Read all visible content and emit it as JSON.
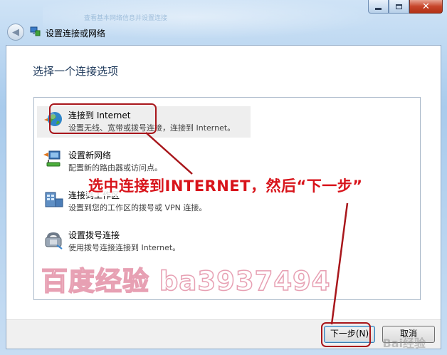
{
  "window": {
    "title": "设置连接或网络",
    "ghost_text": "查看基本网络信息并设置连接",
    "caption": {
      "minimize": "minimize-icon",
      "maximize": "maximize-icon",
      "close": "close-icon"
    }
  },
  "dialog": {
    "heading": "选择一个连接选项",
    "options": [
      {
        "title": "连接到 Internet",
        "desc": "设置无线、宽带或拨号连接，连接到 Internet。",
        "icon": "globe-network-icon",
        "selected": true
      },
      {
        "title": "设置新网络",
        "desc": "配置新的路由器或访问点。",
        "icon": "router-icon",
        "selected": false
      },
      {
        "title": "连接到工作区",
        "desc": "设置到您的工作区的拨号或 VPN 连接。",
        "icon": "workplace-icon",
        "selected": false
      },
      {
        "title": "设置拨号连接",
        "desc": "使用拨号连接连接到 Internet。",
        "icon": "phone-icon",
        "selected": false
      }
    ],
    "buttons": {
      "next": "下一步(N)",
      "cancel": "取消"
    }
  },
  "annotation": {
    "text": "选中连接到INTERNET，然后“下一步”",
    "color": "#d8141b"
  },
  "watermark": {
    "text": "百度经验 ba3937494",
    "corner": "Bai经验"
  },
  "colors": {
    "accent": "#a8161b",
    "heading": "#1e395b"
  }
}
